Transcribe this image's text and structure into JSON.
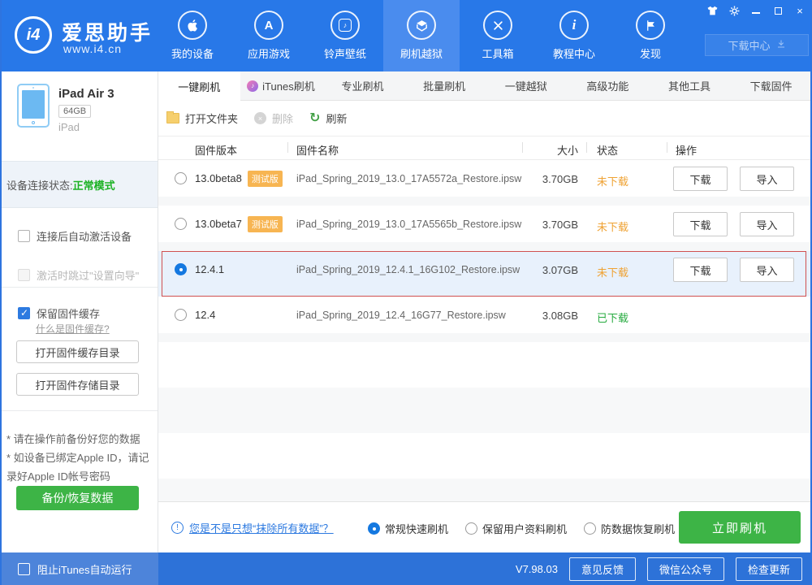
{
  "header": {
    "brand": {
      "logo_text": "i4",
      "name": "爱思助手",
      "url": "www.i4.cn"
    },
    "nav": [
      {
        "label": "我的设备"
      },
      {
        "label": "应用游戏"
      },
      {
        "label": "铃声壁纸"
      },
      {
        "label": "刷机越狱"
      },
      {
        "label": "工具箱"
      },
      {
        "label": "教程中心"
      },
      {
        "label": "发现"
      }
    ],
    "download_center": "下载中心"
  },
  "sidebar": {
    "device": {
      "name": "iPad Air 3",
      "capacity": "64GB",
      "type": "iPad"
    },
    "connection": {
      "label": "设备连接状态: ",
      "value": "正常模式"
    },
    "options": [
      {
        "label": "连接后自动激活设备"
      },
      {
        "label": "激活时跳过\"设置向导\""
      },
      {
        "label": "保留固件缓存"
      }
    ],
    "cache_link": "什么是固件缓存?",
    "open_cache_btn": "打开固件缓存目录",
    "open_storage_btn": "打开固件存储目录",
    "notes": [
      "* 请在操作前备份好您的数据",
      "* 如设备已绑定Apple ID，请记录好Apple ID帐号密码"
    ],
    "backup_btn": "备份/恢复数据"
  },
  "tabs": [
    "一键刷机",
    "iTunes刷机",
    "专业刷机",
    "批量刷机",
    "一键越狱",
    "高级功能",
    "其他工具",
    "下载固件"
  ],
  "toolbar": {
    "open_folder": "打开文件夹",
    "delete": "删除",
    "refresh": "刷新"
  },
  "table": {
    "headers": [
      "固件版本",
      "固件名称",
      "大小",
      "状态",
      "操作"
    ],
    "download_label": "下载",
    "import_label": "导入",
    "rows": [
      {
        "version": "13.0beta8",
        "badge": "测试版",
        "name": "iPad_Spring_2019_13.0_17A5572a_Restore.ipsw",
        "size": "3.70GB",
        "status": "未下载"
      },
      {
        "version": "13.0beta7",
        "badge": "测试版",
        "name": "iPad_Spring_2019_13.0_17A5565b_Restore.ipsw",
        "size": "3.70GB",
        "status": "未下载"
      },
      {
        "version": "12.4.1",
        "name": "iPad_Spring_2019_12.4.1_16G102_Restore.ipsw",
        "size": "3.07GB",
        "status": "未下载"
      },
      {
        "version": "12.4",
        "name": "iPad_Spring_2019_12.4_16G77_Restore.ipsw",
        "size": "3.08GB",
        "status": "已下载"
      }
    ]
  },
  "footer": {
    "hint_link": "您是不是只想“抹除所有数据”？",
    "modes": [
      {
        "label": "常规快速刷机"
      },
      {
        "label": "保留用户资料刷机"
      },
      {
        "label": "防数据恢复刷机"
      }
    ],
    "flash_btn": "立即刷机"
  },
  "statusbar": {
    "block_itunes": "阻止iTunes自动运行",
    "version": "V7.98.03",
    "buttons": [
      "意见反馈",
      "微信公众号",
      "检查更新"
    ]
  },
  "icons": {
    "appstore_letter": "A",
    "note": "♪",
    "tutorial_letter": "i",
    "close": "×",
    "minus": "–",
    "refresh": "↻",
    "delete_x": "×",
    "exclaim": "!",
    "question": "?"
  },
  "colors": {
    "header_blue": "#2878e8",
    "accent_green": "#3db446",
    "status_orange": "#efa233",
    "status_green": "#27ab40",
    "link_blue": "#2d7ae0",
    "selection_red": "#d05050"
  }
}
